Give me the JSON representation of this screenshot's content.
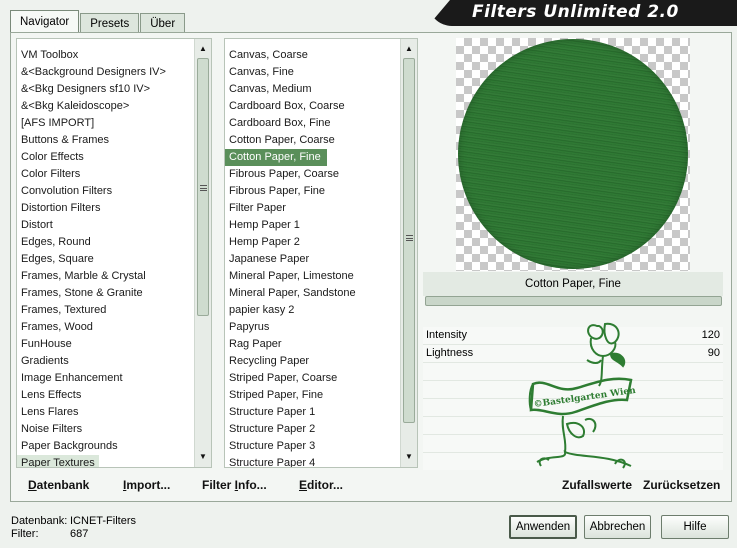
{
  "title": "Filters Unlimited 2.0",
  "tabs": [
    "Navigator",
    "Presets",
    "Über"
  ],
  "categories": [
    "VM Toolbox",
    "&<Background Designers IV>",
    "&<Bkg Designers sf10 IV>",
    "&<Bkg Kaleidoscope>",
    "[AFS IMPORT]",
    "Buttons & Frames",
    "Color Effects",
    "Color Filters",
    "Convolution Filters",
    "Distortion Filters",
    "Distort",
    "Edges, Round",
    "Edges, Square",
    "Frames, Marble & Crystal",
    "Frames, Stone & Granite",
    "Frames, Textured",
    "Frames, Wood",
    "FunHouse",
    "Gradients",
    "Image Enhancement",
    "Lens Effects",
    "Lens Flares",
    "Noise Filters",
    "Paper Backgrounds",
    "Paper Textures"
  ],
  "selected_category": "Paper Textures",
  "filters": [
    "Canvas, Coarse",
    "Canvas, Fine",
    "Canvas, Medium",
    "Cardboard Box, Coarse",
    "Cardboard Box, Fine",
    "Cotton Paper, Coarse",
    "Cotton Paper, Fine",
    "Fibrous Paper, Coarse",
    "Fibrous Paper, Fine",
    "Filter Paper",
    "Hemp Paper 1",
    "Hemp Paper 2",
    "Japanese Paper",
    "Mineral Paper, Limestone",
    "Mineral Paper, Sandstone",
    "papier kasy 2",
    "Papyrus",
    "Rag Paper",
    "Recycling Paper",
    "Striped Paper, Coarse",
    "Striped Paper, Fine",
    "Structure Paper 1",
    "Structure Paper 2",
    "Structure Paper 3",
    "Structure Paper 4"
  ],
  "selected_filter": "Cotton Paper, Fine",
  "preview_filter_name": "Cotton Paper, Fine",
  "params": [
    {
      "name": "Intensity",
      "value": "120"
    },
    {
      "name": "Lightness",
      "value": "90"
    }
  ],
  "watermark": "©Bastelgarten Wien",
  "left_buttons": {
    "datenbank": {
      "first": "D",
      "rest": "atenbank"
    },
    "import": {
      "first": "I",
      "rest": "mport..."
    },
    "filter_info": {
      "pre": "Filter ",
      "first": "I",
      "rest": "nfo..."
    },
    "editor": {
      "first": "E",
      "rest": "ditor..."
    }
  },
  "right_buttons": {
    "zufallswerte": "Zufallswerte",
    "zuruecksetzen": "Zurücksetzen"
  },
  "footer": {
    "datenbank_label": "Datenbank:",
    "datenbank_value": "ICNET-Filters",
    "filter_label": "Filter:",
    "filter_value": "687"
  },
  "dialog_buttons": {
    "apply": "Anwenden",
    "cancel": "Abbrechen",
    "help": "Hilfe"
  },
  "colors": {
    "selection": "#5a8f5a",
    "preview_green": "#2f7a34",
    "logo_green": "#2e7d32"
  }
}
